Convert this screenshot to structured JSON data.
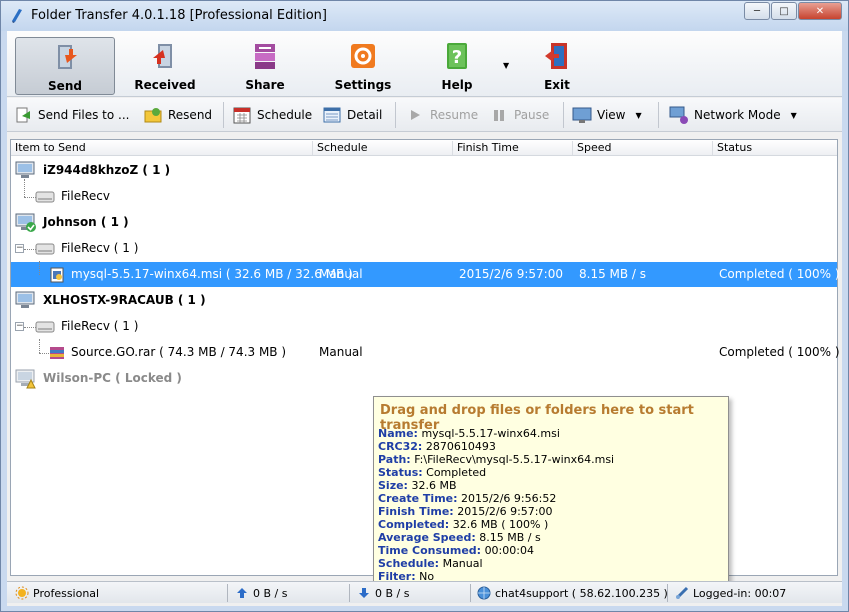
{
  "window": {
    "title": "Folder Transfer 4.0.1.18  [Professional Edition]"
  },
  "bigbar": [
    {
      "label": "Send"
    },
    {
      "label": "Received"
    },
    {
      "label": "Share"
    },
    {
      "label": "Settings"
    },
    {
      "label": "Help"
    },
    {
      "label": "Exit"
    }
  ],
  "toolbar": {
    "send_files": "Send Files to ...",
    "resend": "Resend",
    "schedule": "Schedule",
    "detail": "Detail",
    "resume": "Resume",
    "pause": "Pause",
    "view": "View",
    "network_mode": "Network Mode"
  },
  "columns": [
    "Item to Send",
    "Schedule",
    "Finish Time",
    "Speed",
    "Status"
  ],
  "rows": {
    "host1": "iZ944d8khzoZ ( 1 )",
    "host1_folder": "FileRecv",
    "host2": "Johnson ( 1 )",
    "host2_folder": "FileRecv ( 1 )",
    "file1": {
      "name": "mysql-5.5.17-winx64.msi ( 32.6 MB / 32.6 MB )",
      "schedule": "Manual",
      "finish": "2015/2/6 9:57:00",
      "speed": "8.15 MB / s",
      "status": "Completed ( 100% )"
    },
    "host3": "XLHOSTX-9RACAUB ( 1 )",
    "host3_folder": "FileRecv ( 1 )",
    "file2": {
      "name": "Source.GO.rar ( 74.3 MB / 74.3 MB )",
      "schedule": "Manual",
      "status": "Completed ( 100% )"
    },
    "host4": "Wilson-PC ( Locked )"
  },
  "tooltip": {
    "hint": "Drag and drop files or folders here to start transfer",
    "fields": [
      {
        "k": "Name:",
        "v": "mysql-5.5.17-winx64.msi"
      },
      {
        "k": "CRC32:",
        "v": "2870610493"
      },
      {
        "k": "Path:",
        "v": "F:\\FileRecv\\mysql-5.5.17-winx64.msi"
      },
      {
        "k": "Status:",
        "v": "Completed"
      },
      {
        "k": "Size:",
        "v": "32.6 MB"
      },
      {
        "k": "Create Time:",
        "v": "2015/2/6 9:56:52"
      },
      {
        "k": "Finish Time:",
        "v": "2015/2/6 9:57:00"
      },
      {
        "k": "Completed:",
        "v": "32.6 MB ( 100% )"
      },
      {
        "k": "Average Speed:",
        "v": "8.15 MB / s"
      },
      {
        "k": "Time Consumed:",
        "v": "00:00:04"
      },
      {
        "k": "Schedule:",
        "v": "Manual"
      },
      {
        "k": "Filter:",
        "v": "No"
      }
    ]
  },
  "status": {
    "edition": "Professional",
    "up": "0 B / s",
    "down": "0 B / s",
    "user": "chat4support ( 58.62.100.235 )",
    "logged": "Logged-in: 00:07"
  }
}
